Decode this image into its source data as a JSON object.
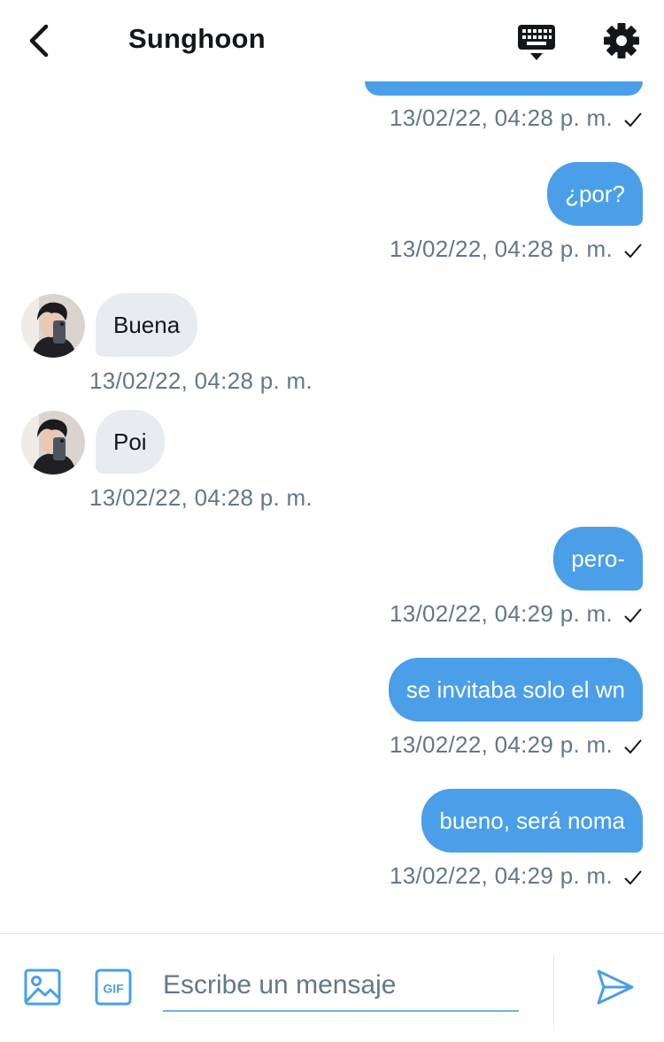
{
  "header": {
    "title": "Sunghoon",
    "back_icon": "chevron-left-icon",
    "keyboard_icon": "keyboard-icon",
    "settings_icon": "gear-icon"
  },
  "messages": [
    {
      "direction": "out",
      "text": "",
      "timestamp": "13/02/22, 04:28 p. m.",
      "read_check": true,
      "partial": true
    },
    {
      "direction": "out",
      "text": "¿por?",
      "timestamp": "13/02/22, 04:28 p. m.",
      "read_check": true
    },
    {
      "direction": "in",
      "text": "Buena",
      "timestamp": "13/02/22, 04:28 p. m."
    },
    {
      "direction": "in",
      "text": "Poi",
      "timestamp": "13/02/22, 04:28 p. m."
    },
    {
      "direction": "out",
      "text": "pero-",
      "timestamp": "13/02/22, 04:29 p. m.",
      "read_check": true
    },
    {
      "direction": "out",
      "text": "se invitaba solo el wn",
      "timestamp": "13/02/22, 04:29 p. m.",
      "read_check": true
    },
    {
      "direction": "out",
      "text": "bueno, será noma",
      "timestamp": "13/02/22, 04:29 p. m.",
      "read_check": true
    }
  ],
  "composer": {
    "placeholder": "Escribe un mensaje",
    "value": "",
    "image_icon": "image-icon",
    "gif_label": "GIF",
    "send_icon": "send-icon"
  },
  "colors": {
    "accent": "#4a9fe8",
    "incoming_bubble": "#e8ebef",
    "timestamp_text": "#657786"
  }
}
